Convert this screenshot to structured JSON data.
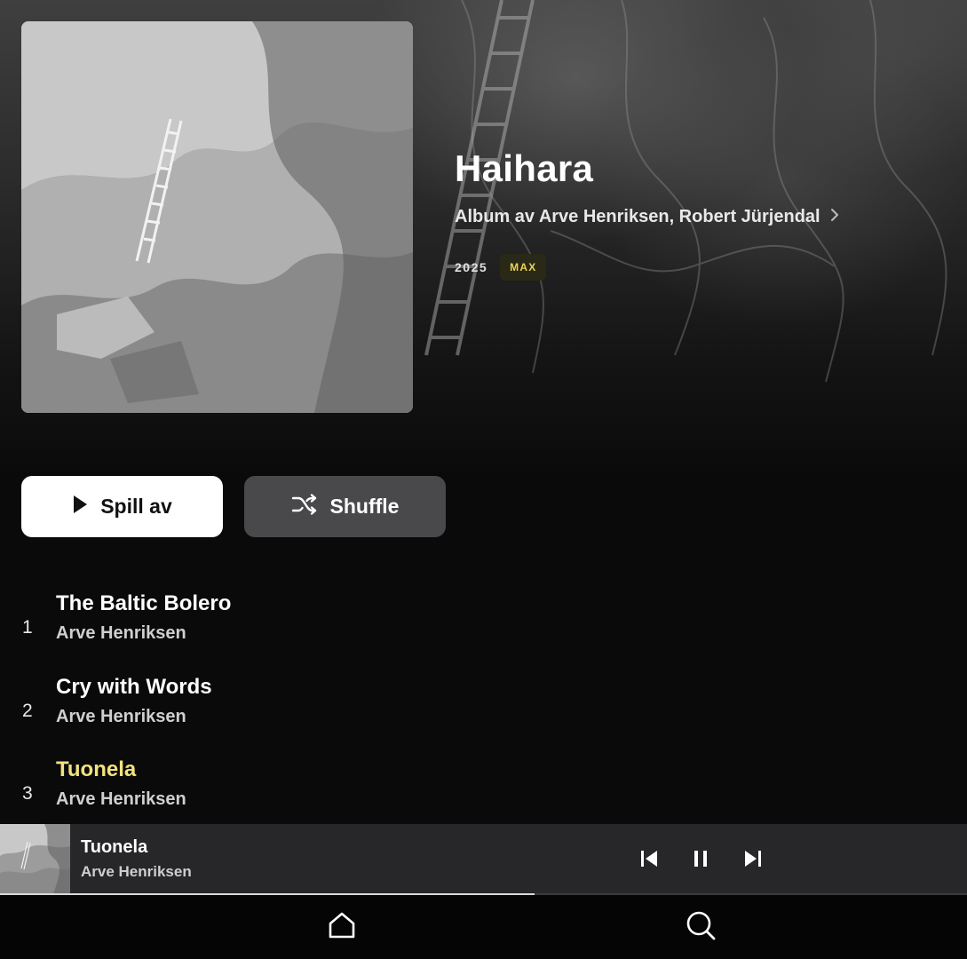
{
  "album": {
    "title": "Haihara",
    "subtitle": "Album av Arve Henriksen, Robert Jürjendal",
    "year": "2025",
    "quality_badge": "MAX"
  },
  "actions": {
    "play_label": "Spill av",
    "shuffle_label": "Shuffle"
  },
  "tracks": [
    {
      "number": "1",
      "title": "The Baltic Bolero",
      "artist": "Arve Henriksen",
      "playing": false
    },
    {
      "number": "2",
      "title": "Cry with Words",
      "artist": "Arve Henriksen",
      "playing": false
    },
    {
      "number": "3",
      "title": "Tuonela",
      "artist": "Arve Henriksen",
      "playing": true
    }
  ],
  "now_playing": {
    "title": "Tuonela",
    "artist": "Arve Henriksen",
    "progress": 0.553
  },
  "nav": {
    "items": [
      "home-icon",
      "search-icon"
    ]
  },
  "colors": {
    "accent_yellow": "#f2e27e",
    "badge_text": "#e9d35a",
    "background": "#0a0a0b",
    "player_bar": "#27272a"
  }
}
